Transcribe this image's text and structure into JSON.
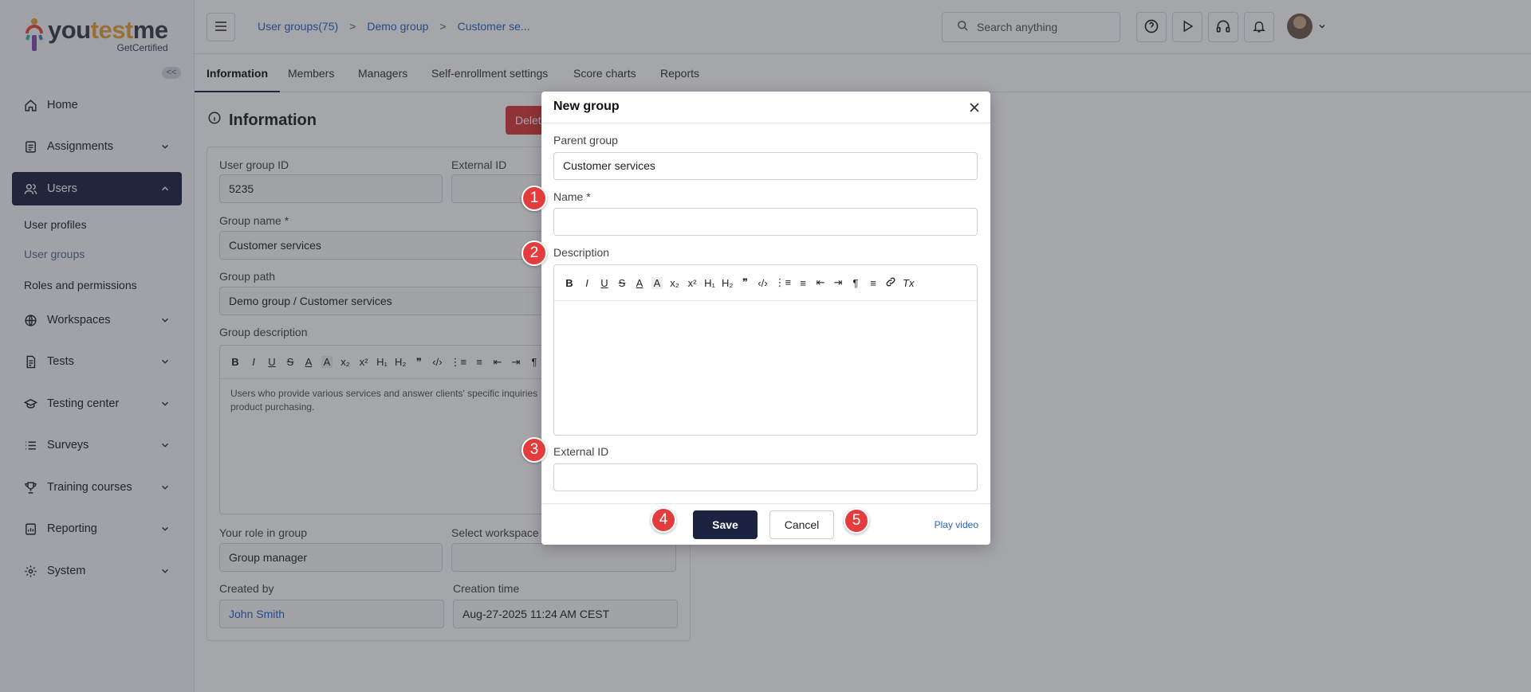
{
  "brand": {
    "name_part1": "you",
    "name_accent": "test",
    "name_part2": "me",
    "tagline": "GetCertified"
  },
  "sidebar": {
    "collapse_label": "<<",
    "items": [
      {
        "label": "Home",
        "icon": "home-icon"
      },
      {
        "label": "Assignments",
        "icon": "clipboard-icon"
      },
      {
        "label": "Users",
        "icon": "users-icon"
      },
      {
        "label": "Workspaces",
        "icon": "globe-icon"
      },
      {
        "label": "Tests",
        "icon": "document-icon"
      },
      {
        "label": "Testing center",
        "icon": "graduation-cap-icon"
      },
      {
        "label": "Surveys",
        "icon": "list-icon"
      },
      {
        "label": "Training courses",
        "icon": "trophy-icon"
      },
      {
        "label": "Reporting",
        "icon": "report-icon"
      },
      {
        "label": "System",
        "icon": "gear-icon"
      }
    ],
    "users_sub": [
      "User profiles",
      "User groups",
      "Roles and permissions"
    ]
  },
  "topbar": {
    "breadcrumb": [
      "User groups(75)",
      "Demo group",
      "Customer se..."
    ],
    "breadcrumb_sep": ">",
    "search_placeholder": "Search anything"
  },
  "tabs": [
    "Information",
    "Members",
    "Managers",
    "Self-enrollment settings",
    "Score charts",
    "Reports"
  ],
  "info": {
    "title": "Information",
    "delete_label": "Delete",
    "user_group_id_label": "User group ID",
    "user_group_id": "5235",
    "external_id_label": "External ID",
    "group_name_label": "Group name",
    "required_mark": "*",
    "group_name": "Customer services",
    "group_path_label": "Group path",
    "group_path": "Demo group / Customer services",
    "group_description_label": "Group description",
    "description_text": "Users who provide various services and answer clients' specific inquiries",
    "description_text2": "product purchasing.",
    "role_label": "Your role in group",
    "role": "Group manager",
    "workspace_label": "Select workspace",
    "created_by_label": "Created by",
    "created_by": "John Smith",
    "creation_time_label": "Creation time",
    "creation_time": "Aug-27-2025 11:24 AM CEST"
  },
  "editor_toolbar": [
    "B",
    "I",
    "U",
    "S",
    "A",
    "A",
    "x₂",
    "x²",
    "H₁",
    "H₂",
    "❞",
    "‹/›",
    "⋮≡",
    "≡",
    "⇤",
    "⇥",
    "¶",
    "≡",
    "🔗",
    "Tx"
  ],
  "modal": {
    "title": "New group",
    "parent_group_label": "Parent group",
    "parent_group": "Customer services",
    "name_label": "Name",
    "required_mark": "*",
    "name_value": "",
    "description_label": "Description",
    "external_id_label": "External ID",
    "external_id_value": "",
    "save_label": "Save",
    "cancel_label": "Cancel",
    "play_video_label": "Play video"
  },
  "markers": [
    "1",
    "2",
    "3",
    "4",
    "5"
  ],
  "colors": {
    "primary": "#1b2340",
    "link": "#2563c9",
    "danger": "#d73a3a",
    "marker": "#e33c3c"
  }
}
